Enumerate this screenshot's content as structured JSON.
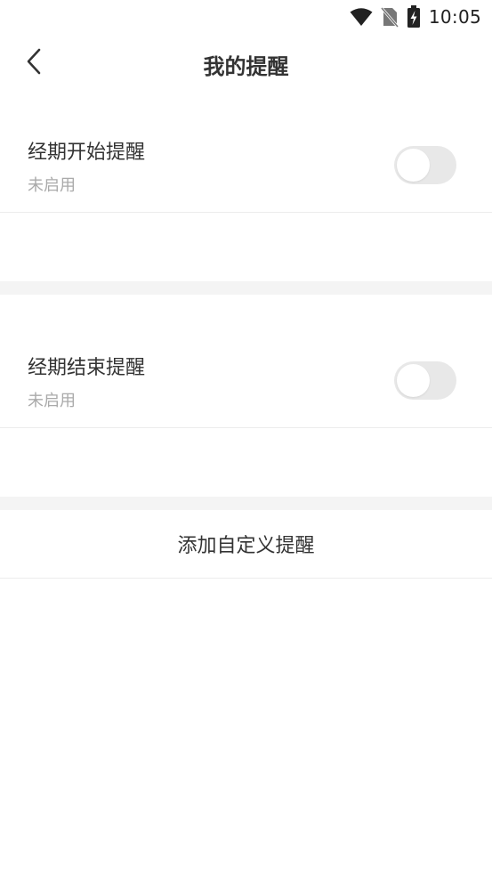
{
  "status_bar": {
    "time": "10:05",
    "icons": [
      "wifi-icon",
      "no-sim-icon",
      "battery-charging-icon"
    ]
  },
  "header": {
    "back_icon": "chevron-left-icon",
    "title": "我的提醒"
  },
  "reminders": [
    {
      "title": "经期开始提醒",
      "status": "未启用",
      "enabled": false
    },
    {
      "title": "经期结束提醒",
      "status": "未启用",
      "enabled": false
    }
  ],
  "add_custom": {
    "label": "添加自定义提醒"
  },
  "colors": {
    "background": "#ffffff",
    "separator": "#f4f4f4",
    "divider": "#ececec",
    "toggle_off": "#e8e8e8",
    "text_primary": "#333333",
    "text_secondary": "#aaaaaa"
  }
}
